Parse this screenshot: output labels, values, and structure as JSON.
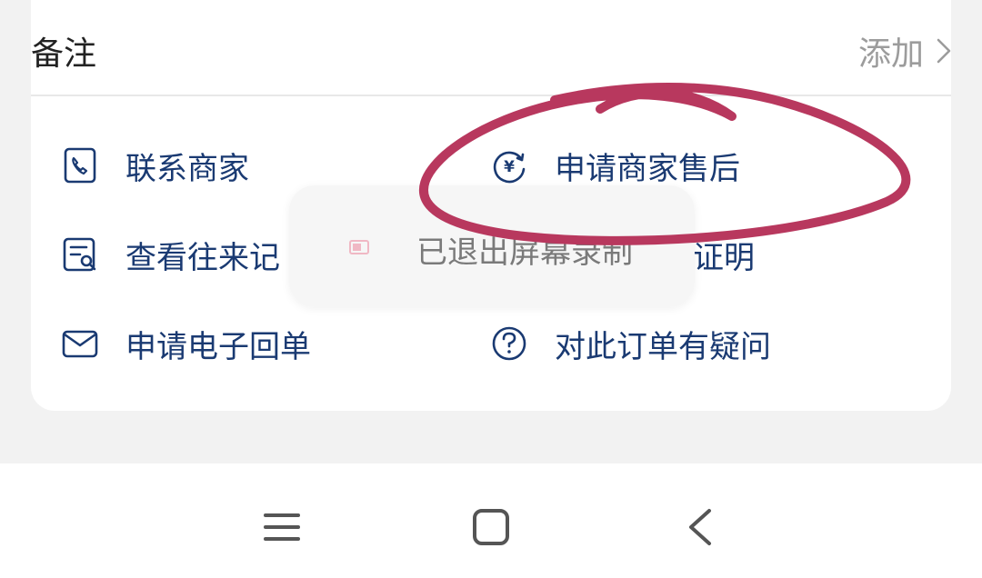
{
  "note": {
    "label": "备注",
    "action": "添加"
  },
  "actions": [
    {
      "label": "联系商家",
      "icon": "phone-card-icon"
    },
    {
      "label": "申请商家售后",
      "icon": "yuan-refresh-icon"
    },
    {
      "label": "查看往来记",
      "icon": "records-search-icon"
    },
    {
      "label": "证明",
      "icon": "certificate-icon"
    },
    {
      "label": "申请电子回单",
      "icon": "envelope-icon"
    },
    {
      "label": "对此订单有疑问",
      "icon": "question-circle-icon"
    }
  ],
  "toast": {
    "text": "已退出屏幕录制",
    "icon": "screen-record-icon"
  },
  "annotation": {
    "color": "#b8385e",
    "shape": "hand-drawn-circle"
  },
  "colors": {
    "accent": "#1a3a72",
    "secondary_text": "#9c9c9c"
  },
  "navbar": {
    "items": [
      "menu-icon",
      "home-icon",
      "back-icon"
    ]
  }
}
